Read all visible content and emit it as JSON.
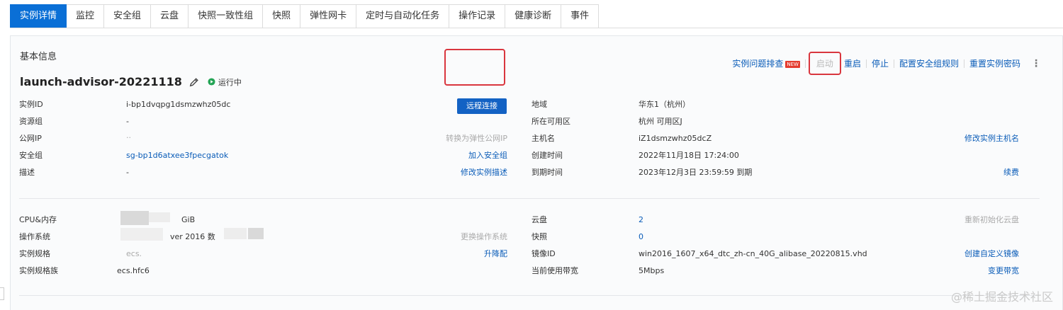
{
  "tabs": [
    "实例详情",
    "监控",
    "安全组",
    "云盘",
    "快照一致性组",
    "快照",
    "弹性网卡",
    "定时与自动化任务",
    "操作记录",
    "健康诊断",
    "事件"
  ],
  "section_title": "基本信息",
  "actions": {
    "troubleshoot": "实例问题排查",
    "new_badge": "NEW",
    "start": "启动",
    "restart": "重启",
    "stop": "停止",
    "config_sg": "配置安全组规则",
    "reset_pwd": "重置实例密码",
    "more": "⋮"
  },
  "instance": {
    "name": "launch-advisor-20221118",
    "status": "运行中"
  },
  "remote_connect": "远程连接",
  "left": {
    "instance_id": {
      "label": "实例ID",
      "value": "i-bp1dvqpg1dsmzwhz05dc"
    },
    "resource_group": {
      "label": "资源组",
      "value": "-"
    },
    "public_ip": {
      "label": "公网IP",
      "value": "..",
      "action": "转换为弹性公网IP"
    },
    "security_group": {
      "label": "安全组",
      "value": "sg-bp1d6atxee3fpecgatok",
      "action": "加入安全组"
    },
    "description": {
      "label": "描述",
      "value": "-",
      "action": "修改实例描述"
    }
  },
  "right": {
    "region": {
      "label": "地域",
      "value": "华东1（杭州）"
    },
    "zone": {
      "label": "所在可用区",
      "value": "杭州 可用区J"
    },
    "hostname": {
      "label": "主机名",
      "value": "iZ1dsmzwhz05dcZ",
      "action": "修改实例主机名"
    },
    "created": {
      "label": "创建时间",
      "value": "2022年11月18日 17:24:00"
    },
    "expire": {
      "label": "到期时间",
      "value": "2023年12月3日 23:59:59 到期",
      "action": "续费"
    }
  },
  "left2": {
    "cpu_mem": {
      "label": "CPU&内存",
      "value": "GiB"
    },
    "os": {
      "label": "操作系统",
      "value": "ver 2016 数",
      "action": "更换操作系统"
    },
    "spec": {
      "label": "实例规格",
      "value": "ecs.",
      "action": "升降配"
    },
    "family": {
      "label": "实例规格族",
      "value": "ecs.hfc6"
    }
  },
  "right2": {
    "disks": {
      "label": "云盘",
      "value": "2",
      "action": "重新初始化云盘"
    },
    "snapshots": {
      "label": "快照",
      "value": "0"
    },
    "image": {
      "label": "镜像ID",
      "value": "win2016_1607_x64_dtc_zh-cn_40G_alibase_20220815.vhd",
      "action": "创建自定义镜像"
    },
    "bandwidth": {
      "label": "当前使用带宽",
      "value": "5Mbps",
      "action": "变更带宽"
    }
  },
  "watermark": "@稀土掘金技术社区",
  "colors": {
    "accent": "#0a6fd6",
    "link": "#0a5cb8",
    "highlight": "#d9363e",
    "status_green": "#23a455"
  }
}
